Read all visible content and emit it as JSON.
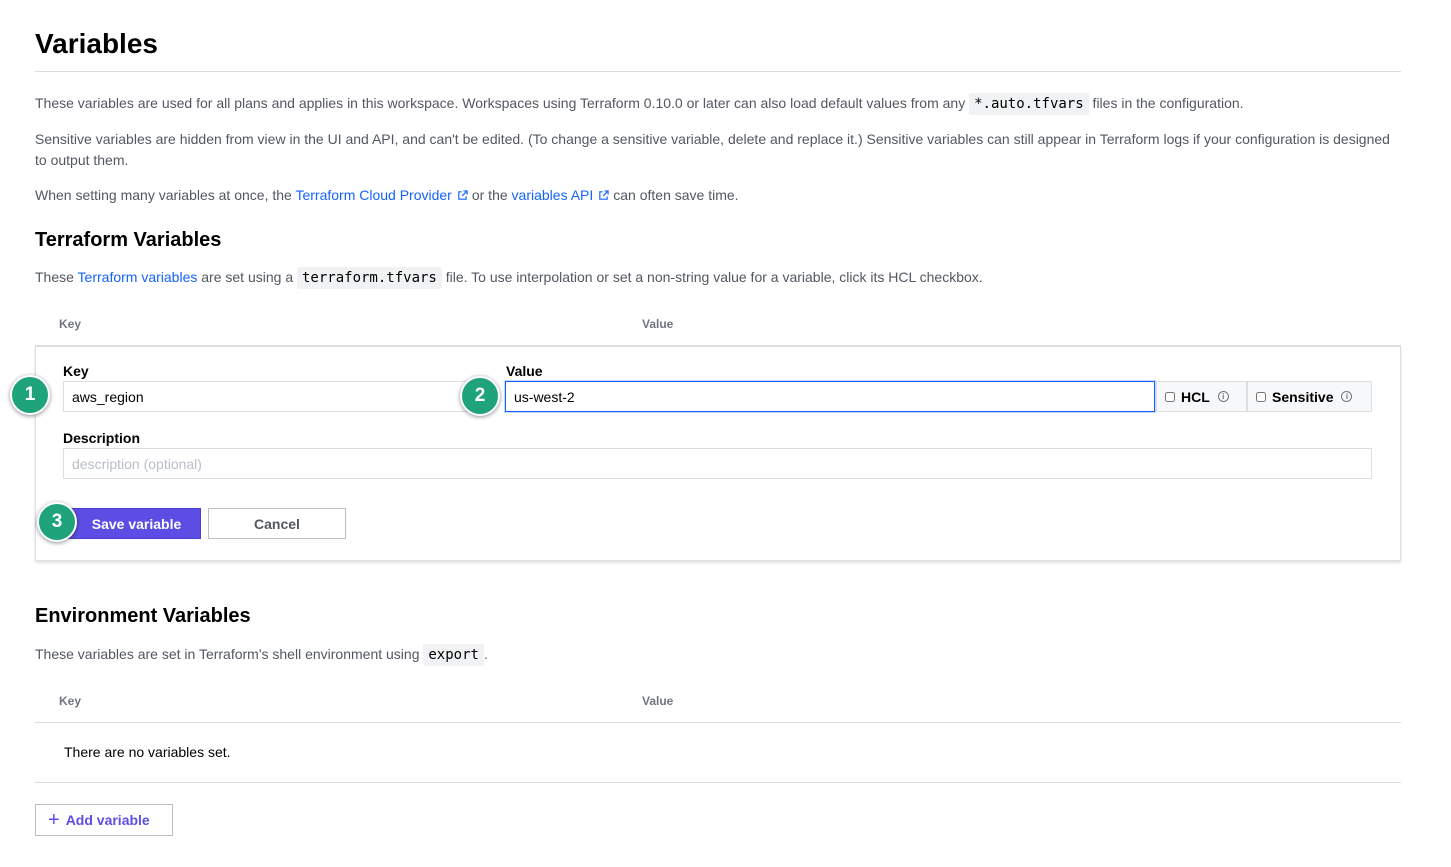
{
  "page": {
    "title": "Variables",
    "intro_1_before": "These variables are used for all plans and applies in this workspace. Workspaces using Terraform 0.10.0 or later can also load default values from any ",
    "intro_1_code": "*.auto.tfvars",
    "intro_1_after": " files in the configuration.",
    "intro_2": "Sensitive variables are hidden from view in the UI and API, and can't be edited. (To change a sensitive variable, delete and replace it.) Sensitive variables can still appear in Terraform logs if your configuration is designed to output them.",
    "intro_3_before": "When setting many variables at once, the ",
    "intro_3_link1": "Terraform Cloud Provider",
    "intro_3_mid": "or the ",
    "intro_3_link2": "variables API",
    "intro_3_after": "can often save time."
  },
  "terraform_section": {
    "heading": "Terraform Variables",
    "desc_before": "These ",
    "desc_link": "Terraform variables",
    "desc_mid": " are set using a ",
    "desc_code": "terraform.tfvars",
    "desc_after": " file. To use interpolation or set a non-string value for a variable, click its HCL checkbox.",
    "col_key": "Key",
    "col_value": "Value",
    "form": {
      "key_label": "Key",
      "key_value": "aws_region",
      "value_label": "Value",
      "value_value": "us-west-2",
      "hcl_label": "HCL",
      "sensitive_label": "Sensitive",
      "description_label": "Description",
      "description_placeholder": "description (optional)",
      "save_label": "Save variable",
      "cancel_label": "Cancel"
    }
  },
  "environment_section": {
    "heading": "Environment Variables",
    "desc_before": "These variables are set in Terraform's shell environment using ",
    "desc_code": "export",
    "desc_after": ".",
    "col_key": "Key",
    "col_value": "Value",
    "empty_text": "There are no variables set.",
    "add_label": "Add variable"
  },
  "annotations": {
    "step_1": "1",
    "step_2": "2",
    "step_3": "3"
  },
  "colors": {
    "primary": "#5c4ee5",
    "link": "#1563ff",
    "badge": "#1ea37a"
  }
}
